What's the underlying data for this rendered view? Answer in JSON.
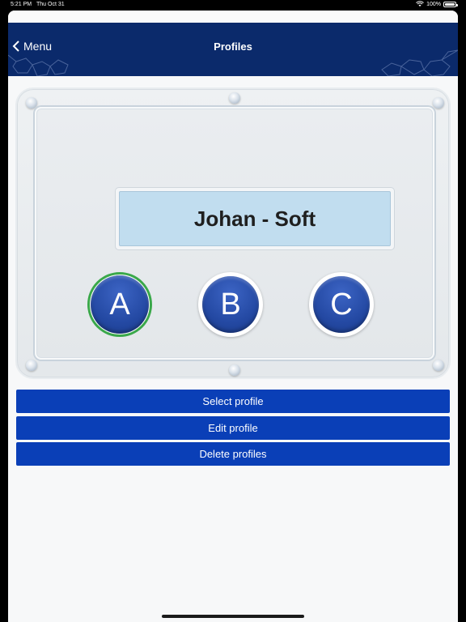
{
  "status_bar": {
    "time": "5:21 PM",
    "date": "Thu Oct 31",
    "battery": "100%"
  },
  "navbar": {
    "back_label": "Menu",
    "title": "Profiles"
  },
  "panel": {
    "current_profile_name": "Johan - Soft",
    "profiles": [
      {
        "label": "A",
        "selected": true
      },
      {
        "label": "B",
        "selected": false
      },
      {
        "label": "C",
        "selected": false
      }
    ]
  },
  "actions": {
    "select_label": "Select profile",
    "edit_label": "Edit profile",
    "delete_label": "Delete profiles"
  },
  "colors": {
    "navbar_bg": "#0b2a6b",
    "button_bg": "#0a3fb7",
    "selected_ring": "#3aa84a",
    "display_bg": "#c1ddef"
  }
}
